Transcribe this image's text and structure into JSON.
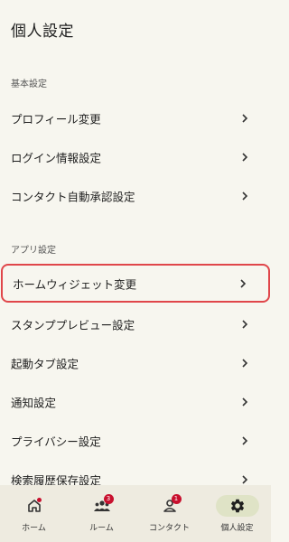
{
  "header": {
    "title": "個人設定"
  },
  "sections": {
    "basic": {
      "title": "基本設定",
      "items": [
        "プロフィール変更",
        "ログイン情報設定",
        "コンタクト自動承認設定"
      ]
    },
    "app": {
      "title": "アプリ設定",
      "items": [
        "ホームウィジェット変更",
        "スタンププレビュー設定",
        "起動タブ設定",
        "通知設定",
        "プライバシー設定",
        "検索履歴保存設定"
      ]
    }
  },
  "bottom_nav": {
    "items": [
      {
        "label": "ホーム",
        "icon": "home-icon",
        "badge": ""
      },
      {
        "label": "ルーム",
        "icon": "room-icon",
        "badge": "3"
      },
      {
        "label": "コンタクト",
        "icon": "contact-icon",
        "badge": "1"
      },
      {
        "label": "個人設定",
        "icon": "gear-icon",
        "badge": ""
      }
    ],
    "active_index": 3
  },
  "colors": {
    "background": "#f7f6ef",
    "highlight_border": "#e0464a",
    "badge": "#c8102e",
    "nav_background": "#eeebe0",
    "active_pill": "#dfe3c6"
  }
}
